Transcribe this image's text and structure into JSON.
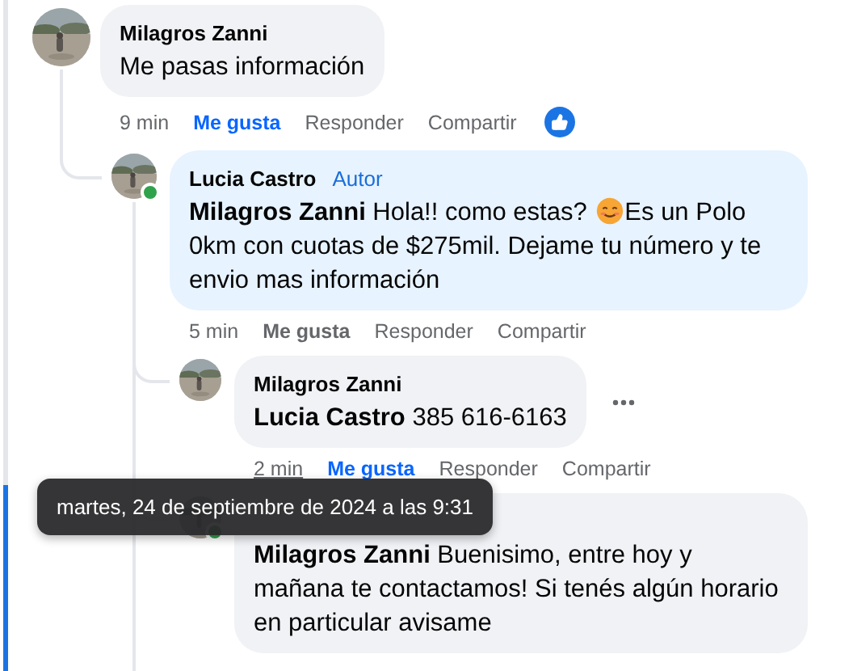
{
  "comments": [
    {
      "author": "Milagros Zanni",
      "body": [
        {
          "kind": "text",
          "text": "Me pasas información"
        }
      ],
      "time": "9 min",
      "time_hovered": false,
      "liked": true,
      "actions": [
        {
          "kind": "like",
          "label": "Me gusta"
        },
        {
          "kind": "reply",
          "label": "Responder"
        },
        {
          "kind": "share",
          "label": "Compartir"
        }
      ],
      "reaction_shown": true,
      "children": [
        {
          "author": "Lucia Castro",
          "online": true,
          "badge": "Autor",
          "body": [
            {
              "kind": "text",
              "text": "**Milagros Zanni** Hola!! como estas? "
            },
            {
              "kind": "emoji"
            },
            {
              "kind": "text",
              "text": "Es un Polo 0km con cuotas de $275mil. Dejame tu número y te envio mas información"
            }
          ],
          "time": "5 min",
          "time_hovered": false,
          "liked": false,
          "actions": [
            {
              "kind": "like",
              "label": "Me gusta"
            },
            {
              "kind": "reply",
              "label": "Responder"
            },
            {
              "kind": "share",
              "label": "Compartir"
            }
          ],
          "children": [
            {
              "author": "Milagros Zanni",
              "body": [
                {
                  "kind": "text",
                  "text": "**Lucia Castro** 385 616-6163"
                }
              ],
              "time": "2 min",
              "time_hovered": true,
              "liked": true,
              "actions": [
                {
                  "kind": "like",
                  "label": "Me gusta"
                },
                {
                  "kind": "reply",
                  "label": "Responder"
                },
                {
                  "kind": "share",
                  "label": "Compartir"
                }
              ],
              "more": true
            },
            {
              "online": true,
              "body": [
                {
                  "kind": "text",
                  "text": "**Milagros Zanni** Buenisimo, entre hoy y mañana te contactamos! Si tenés algún horario en particular avisame"
                }
              ]
            }
          ]
        }
      ]
    }
  ],
  "tooltip": {
    "text": "martes, 24 de septiembre de 2024 a las 9:31"
  }
}
